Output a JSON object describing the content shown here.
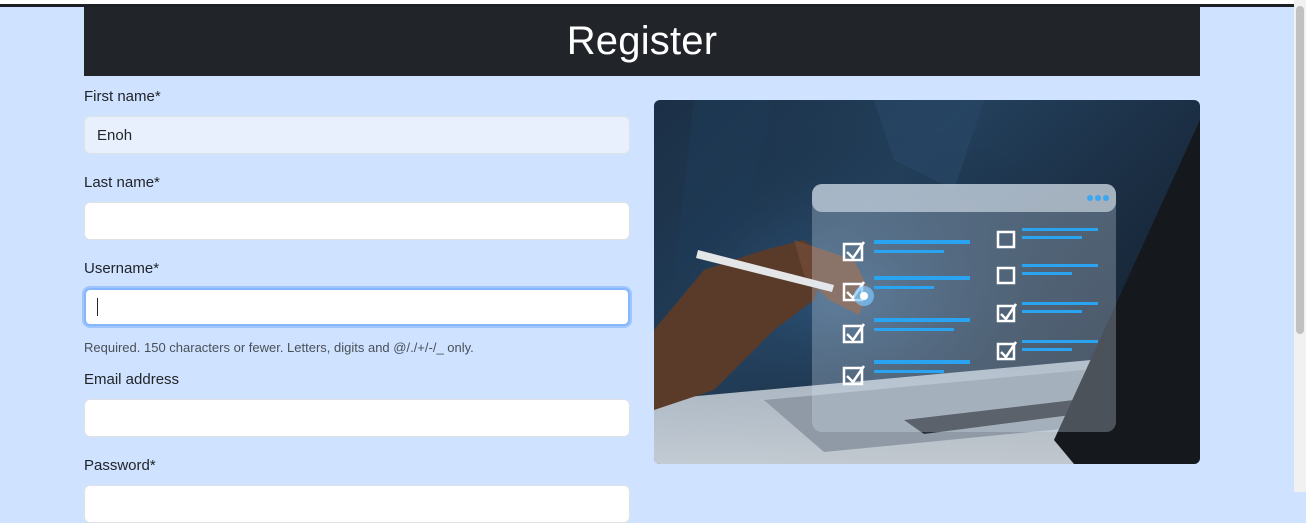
{
  "header": {
    "title": "Register"
  },
  "form": {
    "first_name": {
      "label": "First name*",
      "value": "Enoh"
    },
    "last_name": {
      "label": "Last name*",
      "value": ""
    },
    "username": {
      "label": "Username*",
      "value": "",
      "help": "Required. 150 characters or fewer. Letters, digits and @/./+/-/_ only."
    },
    "email": {
      "label": "Email address",
      "value": ""
    },
    "password": {
      "label": "Password*",
      "value": ""
    }
  },
  "hero_image": {
    "icon": "checklist-laptop-illustration"
  },
  "colors": {
    "page_bg": "#cfe2ff",
    "header_bg": "#212529",
    "focus": "#86b7fe"
  }
}
